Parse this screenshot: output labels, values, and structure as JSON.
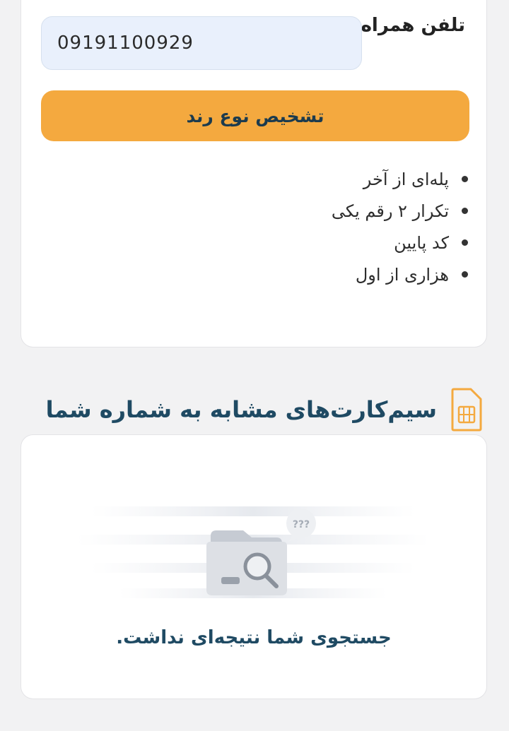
{
  "form": {
    "phone_label": "تلفن همراه",
    "phone_value": "09191100929",
    "detect_button_label": "تشخیص نوع رند"
  },
  "patterns": [
    "پله‌ای از آخر",
    "تکرار ۲ رقم یکی",
    "کد پایین",
    "هزاری از اول"
  ],
  "similar_section": {
    "title": "سیم‌کارت‌های مشابه به شماره شما",
    "icon": "sim-card-icon",
    "empty_message": "جستجوی شما نتیجه‌ای نداشت.",
    "empty_icon": "empty-search-folder-icon",
    "bubble_text": "???"
  },
  "colors": {
    "accent": "#f4a93f",
    "title": "#1f4a63",
    "input_bg": "#e9f0fc",
    "page_bg": "#f2f2f3"
  }
}
